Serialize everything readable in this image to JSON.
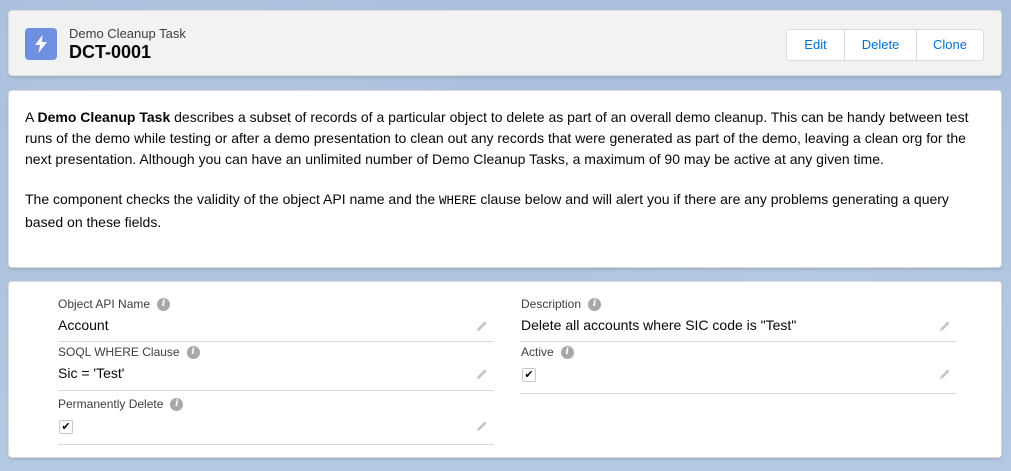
{
  "header": {
    "object_type": "Demo Cleanup Task",
    "record_name": "DCT-0001",
    "icon": "lightning-bolt-icon",
    "icon_color": "#6f8fe0",
    "buttons": {
      "edit": "Edit",
      "delete": "Delete",
      "clone": "Clone"
    }
  },
  "description": {
    "p1_prefix": "A ",
    "p1_bold": "Demo Cleanup Task",
    "p1_rest": " describes a subset of records of a particular object to delete as part of an overall demo cleanup. This can be handy between test runs of the demo while testing or after a demo presentation to clean out any records that were generated as part of the demo, leaving a clean org for the next presentation. Although you can have an unlimited number of Demo Cleanup Tasks, a maximum of 90 may be active at any given time.",
    "p2_prefix": "The component checks the validity of the object API name and the ",
    "p2_code": "WHERE",
    "p2_rest": " clause below and will alert you if there are any problems generating a query based on these fields."
  },
  "fields": {
    "object_api_name": {
      "label": "Object API Name",
      "value": "Account"
    },
    "description": {
      "label": "Description",
      "value": "Delete all accounts where SIC code is \"Test\""
    },
    "soql_where": {
      "label": "SOQL WHERE Clause",
      "value": "Sic = 'Test'"
    },
    "active": {
      "label": "Active",
      "checked": true,
      "mark": "✔"
    },
    "permanently_delete": {
      "label": "Permanently Delete",
      "checked": true,
      "mark": "✔"
    }
  },
  "colors": {
    "link": "#0070d2",
    "background": "#b0c4df"
  }
}
